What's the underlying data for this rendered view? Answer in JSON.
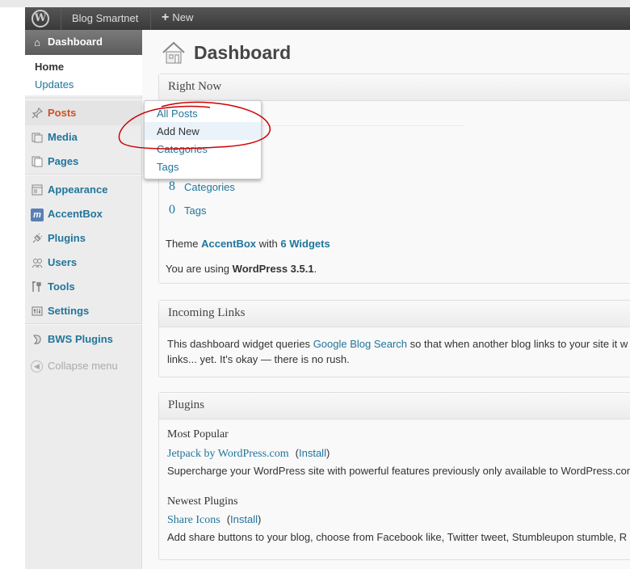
{
  "adminbar": {
    "logo": "W",
    "site_name": "Blog Smartnet",
    "new_label": "New"
  },
  "sidebar": {
    "dashboard": "Dashboard",
    "sub_home": "Home",
    "sub_updates": "Updates",
    "items": [
      {
        "label": "Posts",
        "icon": "pin-icon"
      },
      {
        "label": "Media",
        "icon": "media-icon"
      },
      {
        "label": "Pages",
        "icon": "pages-icon"
      },
      {
        "label": "Appearance",
        "icon": "appearance-icon"
      },
      {
        "label": "AccentBox",
        "icon": "accentbox-icon"
      },
      {
        "label": "Plugins",
        "icon": "plug-icon"
      },
      {
        "label": "Users",
        "icon": "users-icon"
      },
      {
        "label": "Tools",
        "icon": "tools-icon"
      },
      {
        "label": "Settings",
        "icon": "settings-icon"
      },
      {
        "label": "BWS Plugins",
        "icon": "bws-icon"
      }
    ],
    "collapse": "Collapse menu"
  },
  "flyout": {
    "items": [
      "All Posts",
      "Add New",
      "Categories",
      "Tags"
    ]
  },
  "page": {
    "title": "Dashboard"
  },
  "right_now": {
    "title": "Right Now",
    "categories_count": "8",
    "categories_label": "Categories",
    "tags_count": "0",
    "tags_label": "Tags",
    "theme_prefix": "Theme",
    "theme_name": "AccentBox",
    "theme_with": "with",
    "widgets_link": "6 Widgets",
    "version_prefix": "You are using",
    "version": "WordPress 3.5.1",
    "version_suffix": "."
  },
  "incoming_links": {
    "title": "Incoming Links",
    "text_before": "This dashboard widget queries",
    "link": "Google Blog Search",
    "text_after": "so that when another blog links to your site it w",
    "text_line2": "links... yet. It's okay — there is no rush."
  },
  "plugins": {
    "title": "Plugins",
    "most_popular": "Most Popular",
    "popular_name": "Jetpack by WordPress.com",
    "popular_install": "Install",
    "popular_desc": "Supercharge your WordPress site with powerful features previously only available to WordPress.com",
    "newest": "Newest Plugins",
    "newest_name": "Share Icons",
    "newest_install": "Install",
    "newest_desc": "Add share buttons to your blog, choose from Facebook like, Twitter tweet, Stumbleupon stumble, R"
  },
  "colors": {
    "link": "#21759b",
    "active_menu": "#d54e21",
    "annotation": "#cc0000"
  }
}
